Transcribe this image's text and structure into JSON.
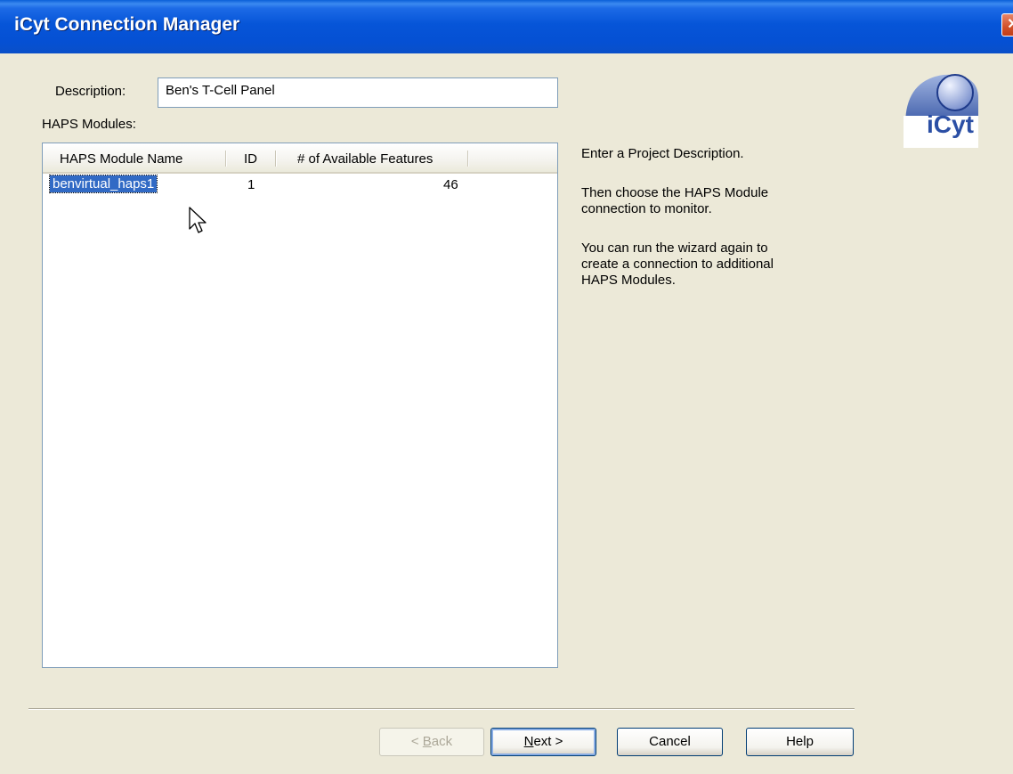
{
  "window": {
    "title": "iCyt Connection Manager",
    "close_glyph": "✕"
  },
  "form": {
    "description_label": "Description:",
    "description_value": "Ben's T-Cell Panel",
    "modules_label": "HAPS Modules:"
  },
  "listview": {
    "columns": [
      "HAPS Module Name",
      "ID",
      "# of Available Features"
    ],
    "rows": [
      {
        "name": "benvirtual_haps1",
        "id": "1",
        "features": "46",
        "selected": true
      }
    ]
  },
  "instructions": {
    "line1": "Enter a Project Description.",
    "line2a": "Then choose the HAPS Module",
    "line2b": "connection to monitor.",
    "line3a": "You can run the wizard again to",
    "line3b": "create a connection to additional",
    "line3c": "HAPS Modules."
  },
  "logo": {
    "text": "iCyt",
    "icon": "icyt-logo-icon"
  },
  "buttons": {
    "back_prefix": "< ",
    "back_key": "B",
    "back_rest": "ack",
    "next_key": "N",
    "next_rest": "ext >",
    "cancel": "Cancel",
    "help": "Help"
  },
  "colors": {
    "titlebar": "#0655D8",
    "selection": "#316AC5",
    "dialog_bg": "#ECE9D8"
  }
}
